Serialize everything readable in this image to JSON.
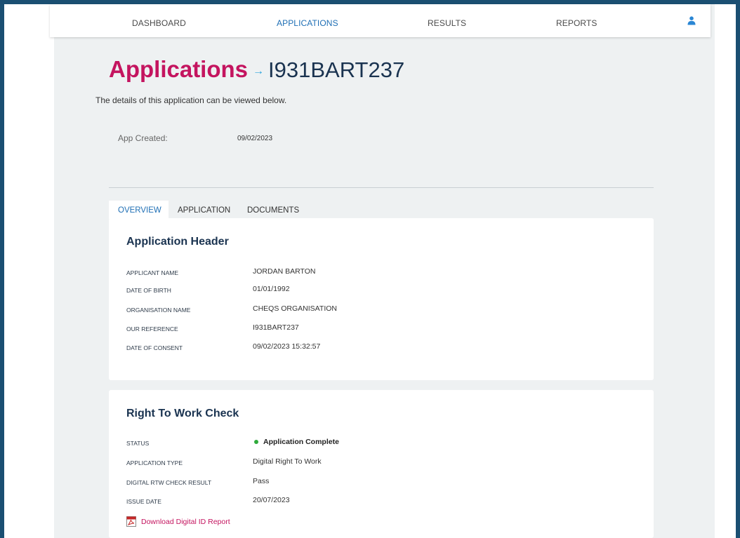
{
  "nav": {
    "items": [
      {
        "label": "DASHBOARD",
        "active": false
      },
      {
        "label": "APPLICATIONS",
        "active": true
      },
      {
        "label": "RESULTS",
        "active": false
      },
      {
        "label": "REPORTS",
        "active": false
      }
    ],
    "user_icon": "user-icon"
  },
  "header": {
    "title": "Applications",
    "arrow": "→",
    "reference": "I931BART237",
    "subtitle": "The details of this application can be viewed below."
  },
  "meta": {
    "created_label": "App Created:",
    "created_value": "09/02/2023"
  },
  "tabs": [
    {
      "label": "OVERVIEW",
      "active": true
    },
    {
      "label": "APPLICATION",
      "active": false
    },
    {
      "label": "DOCUMENTS",
      "active": false
    }
  ],
  "application_header": {
    "title": "Application Header",
    "rows": [
      {
        "label": "APPLICANT NAME",
        "value": "JORDAN BARTON"
      },
      {
        "label": "DATE OF BIRTH",
        "value": "01/01/1992"
      },
      {
        "label": "ORGANISATION NAME",
        "value": "CHEQS ORGANISATION"
      },
      {
        "label": "OUR REFERENCE",
        "value": "I931BART237"
      },
      {
        "label": "DATE OF CONSENT",
        "value": "09/02/2023 15:32:57"
      }
    ]
  },
  "right_to_work": {
    "title": "Right To Work Check",
    "status": {
      "label": "STATUS",
      "value": "Application Complete",
      "color": "#2eaa3b"
    },
    "rows": [
      {
        "label": "APPLICATION TYPE",
        "value": "Digital Right To Work"
      },
      {
        "label": "DIGITAL RTW CHECK RESULT",
        "value": "Pass"
      },
      {
        "label": "ISSUE DATE",
        "value": "20/07/2023"
      }
    ],
    "download": {
      "label": "Download Digital ID Report",
      "icon": "pdf-icon"
    }
  },
  "colors": {
    "brand": "#c4145f",
    "accent": "#1f6fb5",
    "heading": "#1a3350",
    "frame": "#1b4f72",
    "background": "#eef1f2"
  }
}
